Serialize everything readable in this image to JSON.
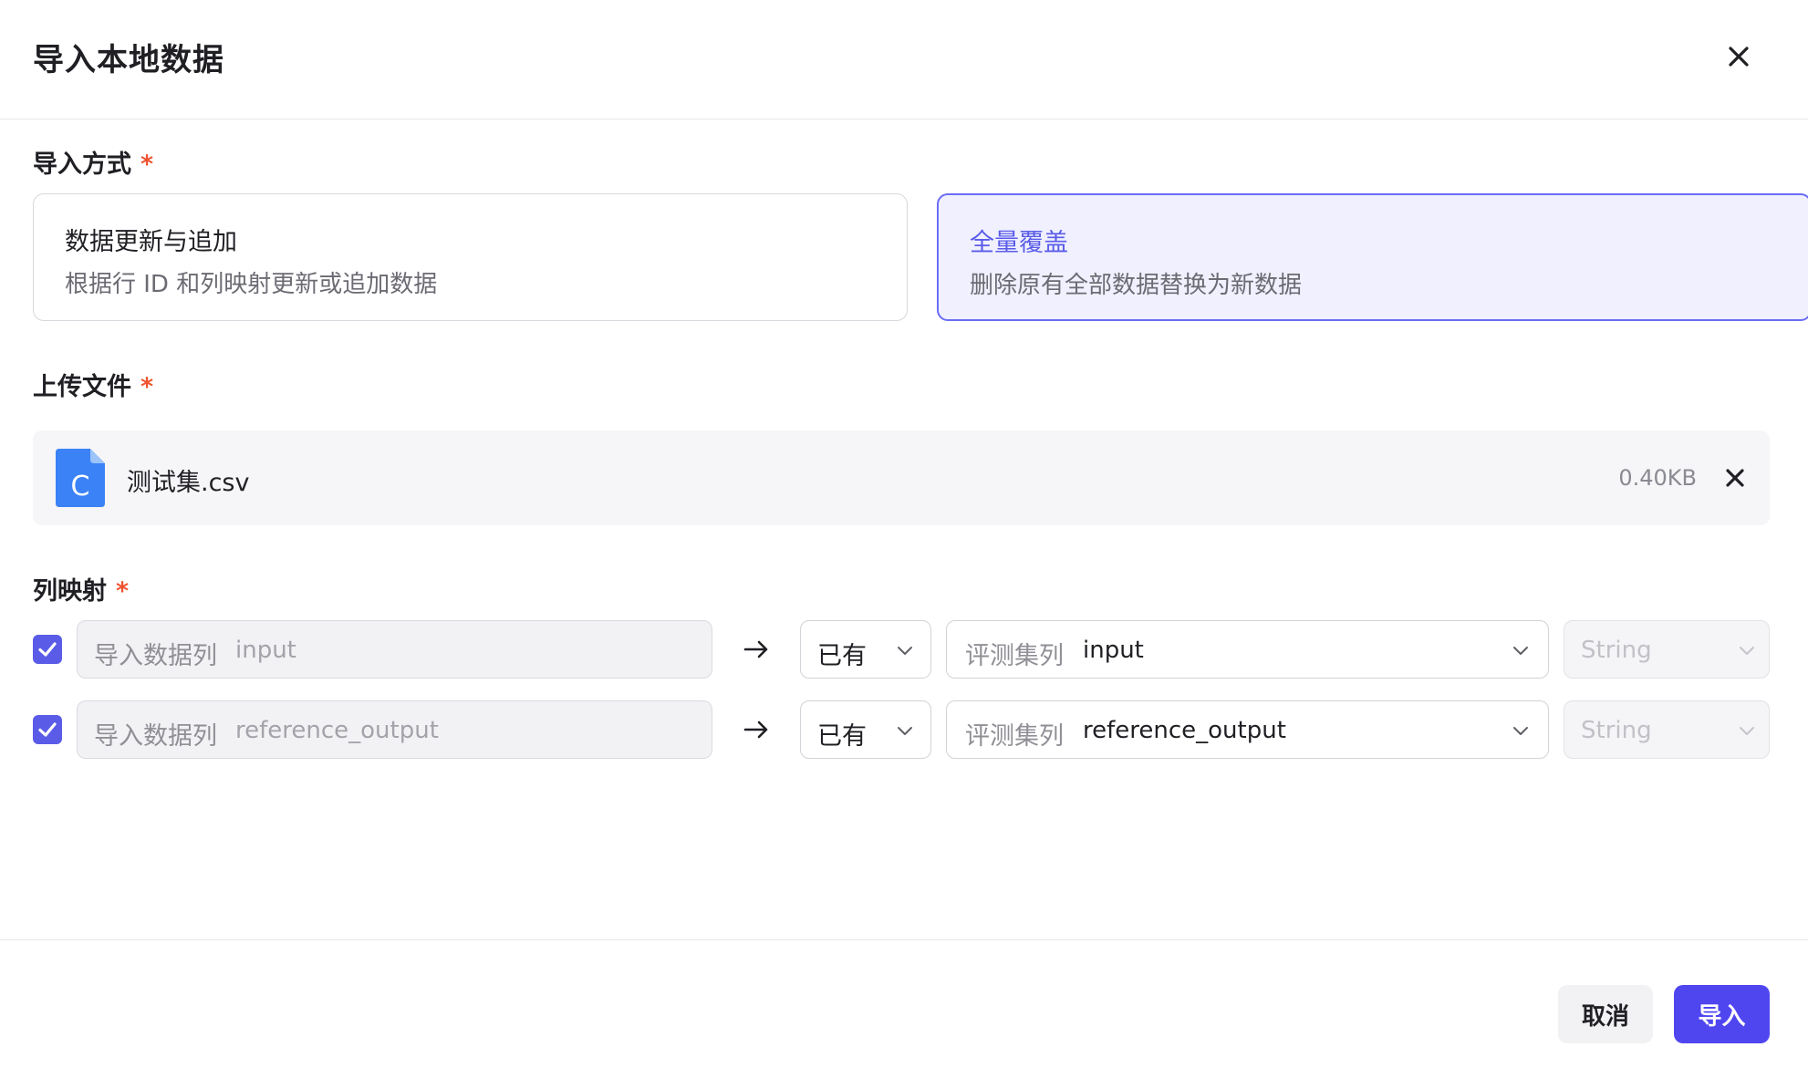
{
  "dialog": {
    "title": "导入本地数据"
  },
  "import_mode": {
    "label": "导入方式",
    "required_mark": "*",
    "options": [
      {
        "title": "数据更新与追加",
        "desc": "根据行 ID 和列映射更新或追加数据",
        "selected": false
      },
      {
        "title": "全量覆盖",
        "desc": "删除原有全部数据替换为新数据",
        "selected": true
      }
    ]
  },
  "upload": {
    "label": "上传文件",
    "required_mark": "*",
    "file": {
      "icon_letter": "C",
      "name": "测试集.csv",
      "size": "0.40KB"
    }
  },
  "mapping": {
    "label": "列映射",
    "required_mark": "*",
    "rows": [
      {
        "checked": true,
        "source_label": "导入数据列",
        "source_value": "input",
        "status": "已有",
        "target_label": "评测集列",
        "target_value": "input",
        "type": "String"
      },
      {
        "checked": true,
        "source_label": "导入数据列",
        "source_value": "reference_output",
        "status": "已有",
        "target_label": "评测集列",
        "target_value": "reference_output",
        "type": "String"
      }
    ]
  },
  "footer": {
    "cancel_label": "取消",
    "import_label": "导入"
  },
  "colors": {
    "accent": "#5046f0",
    "selected_border": "#6a6cf6",
    "selected_bg": "#f0f0ff",
    "required": "#f0522f",
    "file_icon": "#3b82f6"
  }
}
